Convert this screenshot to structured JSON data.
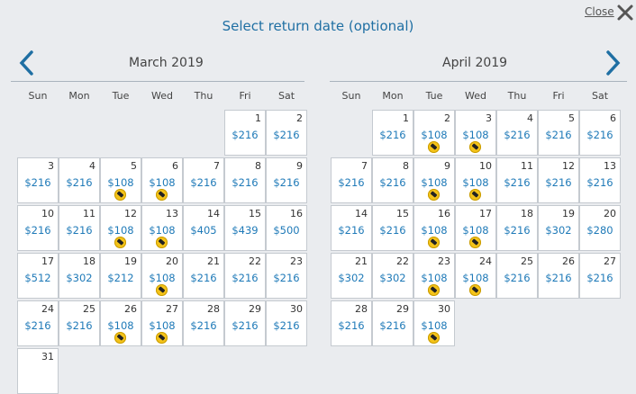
{
  "header": {
    "title": "Select return date (optional)",
    "close_label": "Close"
  },
  "calendar_left": {
    "title": "March 2019",
    "weekdays": [
      "Sun",
      "Mon",
      "Tue",
      "Wed",
      "Thu",
      "Fri",
      "Sat"
    ],
    "first_weekday": 5,
    "days": [
      {
        "d": "1",
        "p": "$216"
      },
      {
        "d": "2",
        "p": "$216"
      },
      {
        "d": "3",
        "p": "$216"
      },
      {
        "d": "4",
        "p": "$216"
      },
      {
        "d": "5",
        "p": "$108",
        "deal": true
      },
      {
        "d": "6",
        "p": "$108",
        "deal": true
      },
      {
        "d": "7",
        "p": "$216"
      },
      {
        "d": "8",
        "p": "$216"
      },
      {
        "d": "9",
        "p": "$216"
      },
      {
        "d": "10",
        "p": "$216"
      },
      {
        "d": "11",
        "p": "$216"
      },
      {
        "d": "12",
        "p": "$108",
        "deal": true
      },
      {
        "d": "13",
        "p": "$108",
        "deal": true
      },
      {
        "d": "14",
        "p": "$405"
      },
      {
        "d": "15",
        "p": "$439"
      },
      {
        "d": "16",
        "p": "$500"
      },
      {
        "d": "17",
        "p": "$512"
      },
      {
        "d": "18",
        "p": "$302"
      },
      {
        "d": "19",
        "p": "$212"
      },
      {
        "d": "20",
        "p": "$108",
        "deal": true
      },
      {
        "d": "21",
        "p": "$216"
      },
      {
        "d": "22",
        "p": "$216"
      },
      {
        "d": "23",
        "p": "$216"
      },
      {
        "d": "24",
        "p": "$216"
      },
      {
        "d": "25",
        "p": "$216"
      },
      {
        "d": "26",
        "p": "$108",
        "deal": true
      },
      {
        "d": "27",
        "p": "$108",
        "deal": true
      },
      {
        "d": "28",
        "p": "$216"
      },
      {
        "d": "29",
        "p": "$216"
      },
      {
        "d": "30",
        "p": "$216"
      },
      {
        "d": "31",
        "p": ""
      }
    ]
  },
  "calendar_right": {
    "title": "April 2019",
    "weekdays": [
      "Sun",
      "Mon",
      "Tue",
      "Wed",
      "Thu",
      "Fri",
      "Sat"
    ],
    "first_weekday": 1,
    "days": [
      {
        "d": "1",
        "p": "$216"
      },
      {
        "d": "2",
        "p": "$108",
        "deal": true
      },
      {
        "d": "3",
        "p": "$108",
        "deal": true
      },
      {
        "d": "4",
        "p": "$216"
      },
      {
        "d": "5",
        "p": "$216"
      },
      {
        "d": "6",
        "p": "$216"
      },
      {
        "d": "7",
        "p": "$216"
      },
      {
        "d": "8",
        "p": "$216"
      },
      {
        "d": "9",
        "p": "$108",
        "deal": true
      },
      {
        "d": "10",
        "p": "$108",
        "deal": true
      },
      {
        "d": "11",
        "p": "$216"
      },
      {
        "d": "12",
        "p": "$216"
      },
      {
        "d": "13",
        "p": "$216"
      },
      {
        "d": "14",
        "p": "$216"
      },
      {
        "d": "15",
        "p": "$216"
      },
      {
        "d": "16",
        "p": "$108",
        "deal": true
      },
      {
        "d": "17",
        "p": "$108",
        "deal": true
      },
      {
        "d": "18",
        "p": "$216"
      },
      {
        "d": "19",
        "p": "$302"
      },
      {
        "d": "20",
        "p": "$280"
      },
      {
        "d": "21",
        "p": "$302"
      },
      {
        "d": "22",
        "p": "$302"
      },
      {
        "d": "23",
        "p": "$108",
        "deal": true
      },
      {
        "d": "24",
        "p": "$108",
        "deal": true
      },
      {
        "d": "25",
        "p": "$216"
      },
      {
        "d": "26",
        "p": "$216"
      },
      {
        "d": "27",
        "p": "$216"
      },
      {
        "d": "28",
        "p": "$216"
      },
      {
        "d": "29",
        "p": "$216"
      },
      {
        "d": "30",
        "p": "$108",
        "deal": true
      }
    ]
  },
  "colors": {
    "accent": "#1f7ab8",
    "price": "#1f7ab8",
    "deal_badge": "#f4c319",
    "background": "#eaecef"
  }
}
